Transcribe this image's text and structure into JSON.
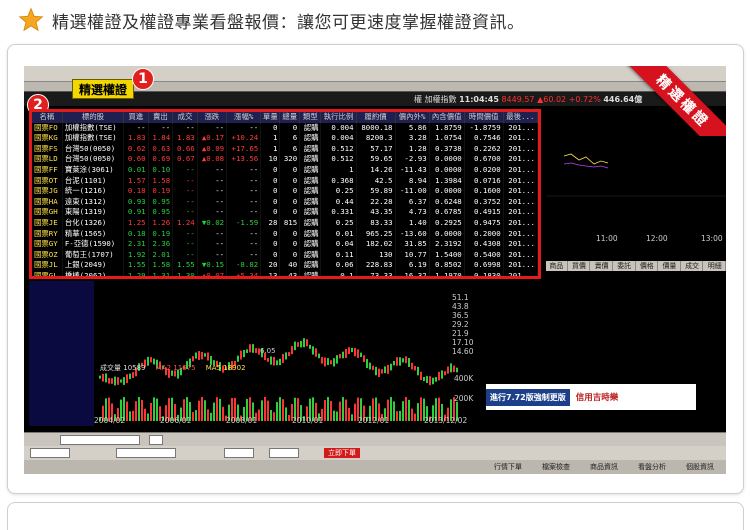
{
  "header": {
    "title": "精選權證及權證專業看盤報價：讓您可更速度掌握權證資訊。"
  },
  "screenshot": {
    "selected_tab": "精選權證",
    "badges": [
      "1",
      "2"
    ],
    "ribbon": "精選權證",
    "quote_prefix": "權",
    "quote_label": "加權指數",
    "quote_time": "11:04:45",
    "quote_index": "8449.57",
    "quote_change": "▲60.02",
    "quote_pct": "+0.72%",
    "quote_volume": "446.64億",
    "columns": [
      "名稱",
      "標的股",
      "買進",
      "賣出",
      "成交",
      "漲跌",
      "漲幅%",
      "單量",
      "總量",
      "類型",
      "執行比例",
      "履約價",
      "價內外%",
      "內含價值",
      "時間價值",
      "最後..."
    ],
    "rows": [
      [
        "國票FO",
        "加權指數(TSE)",
        "--",
        "--",
        "--",
        "--",
        "--",
        "0",
        "0",
        "認購",
        "0.004",
        "8000.18",
        "5.86",
        "1.8759",
        "-1.8759",
        "201..."
      ],
      [
        "國票KG",
        "加權指數(TSE)",
        "1.83",
        "1.84",
        "1.83",
        "▲0.17",
        "+10.24",
        "1",
        "6",
        "認購",
        "0.004",
        "8200.3",
        "3.28",
        "1.0754",
        "0.7546",
        "201..."
      ],
      [
        "國票FS",
        "台灣50(0050)",
        "0.62",
        "0.63",
        "0.66",
        "▲0.09",
        "+17.65",
        "1",
        "6",
        "認購",
        "0.512",
        "57.17",
        "1.28",
        "0.3738",
        "0.2262",
        "201..."
      ],
      [
        "國票LD",
        "台灣50(0050)",
        "0.60",
        "0.69",
        "0.67",
        "▲0.08",
        "+13.56",
        "10",
        "320",
        "認購",
        "0.512",
        "59.65",
        "-2.93",
        "0.0000",
        "0.6700",
        "201..."
      ],
      [
        "國票FF",
        "寶萊涂(3061)",
        "0.01",
        "0.10",
        "--",
        "--",
        "--",
        "0",
        "0",
        "認購",
        "1",
        "14.26",
        "-11.43",
        "0.0000",
        "0.0200",
        "201..."
      ],
      [
        "國票OT",
        "台泥(1101)",
        "1.57",
        "1.58",
        "--",
        "--",
        "--",
        "0",
        "0",
        "認購",
        "0.368",
        "42.5",
        "8.94",
        "1.3984",
        "0.0716",
        "201..."
      ],
      [
        "國票JG",
        "統一(1216)",
        "0.18",
        "0.19",
        "--",
        "--",
        "--",
        "0",
        "0",
        "認購",
        "0.25",
        "59.89",
        "-11.00",
        "0.0000",
        "0.1600",
        "201..."
      ],
      [
        "國票HA",
        "遠東(1312)",
        "0.93",
        "0.95",
        "--",
        "--",
        "--",
        "0",
        "0",
        "認購",
        "0.44",
        "22.28",
        "6.37",
        "0.6248",
        "0.3752",
        "201..."
      ],
      [
        "國票GH",
        "東陽(1319)",
        "0.91",
        "0.95",
        "--",
        "--",
        "--",
        "0",
        "0",
        "認購",
        "0.331",
        "43.35",
        "4.73",
        "0.6785",
        "0.4915",
        "201..."
      ],
      [
        "國票JE",
        "台化(1326)",
        "1.25",
        "1.26",
        "1.24",
        "▼0.02",
        "-1.59",
        "28",
        "815",
        "認購",
        "0.25",
        "83.33",
        "1.40",
        "0.2925",
        "0.9475",
        "201..."
      ],
      [
        "國票RY",
        "精華(1565)",
        "0.18",
        "0.19",
        "--",
        "--",
        "--",
        "0",
        "0",
        "認購",
        "0.01",
        "965.25",
        "-13.60",
        "0.0000",
        "0.2000",
        "201..."
      ],
      [
        "國票GY",
        "F-亞德(1590)",
        "2.31",
        "2.36",
        "--",
        "--",
        "--",
        "0",
        "0",
        "認購",
        "0.04",
        "182.02",
        "31.85",
        "2.3192",
        "0.4308",
        "201..."
      ],
      [
        "國票OZ",
        "葡萄王(1707)",
        "1.92",
        "2.01",
        "--",
        "--",
        "--",
        "0",
        "0",
        "認購",
        "0.11",
        "130",
        "10.77",
        "1.5400",
        "0.5400",
        "201..."
      ],
      [
        "國票JL",
        "上銀(2049)",
        "1.55",
        "1.58",
        "1.55",
        "▼0.15",
        "-8.82",
        "20",
        "40",
        "認購",
        "0.06",
        "228.83",
        "6.19",
        "0.8502",
        "0.6998",
        "201..."
      ],
      [
        "國票GL",
        "橋椿(2062)",
        "1.29",
        "1.31",
        "1.30",
        "▲0.07",
        "+5.34",
        "13",
        "43",
        "認購",
        "0.1",
        "73.33",
        "16.32",
        "1.1970",
        "0.1830",
        "201..."
      ],
      [
        "國票KF",
        "正新(2105)",
        "0.22",
        "0.23",
        "0.18",
        "▼0.01",
        "-5.26",
        "1",
        "1",
        "認購",
        "0.2",
        "86.89",
        "-12.42",
        "0.0000",
        "0.1800",
        "201..."
      ],
      [
        "國票FF",
        "建大(2106)",
        "--",
        "--",
        "--",
        "--",
        "--",
        "0",
        "0",
        "認購",
        "0.161",
        "67.85",
        "-7.59",
        "0.0000",
        "0.0000",
        "201..."
      ]
    ],
    "row_colors": [
      "w",
      "r",
      "r",
      "r",
      "g",
      "r",
      "r",
      "g",
      "g",
      "r",
      "g",
      "g",
      "g",
      "g",
      "g",
      "r",
      "g"
    ],
    "change_colors": [
      "",
      "r",
      "r",
      "r",
      "",
      "",
      "",
      "",
      "",
      "g",
      "",
      "",
      "",
      "g",
      "r",
      "g",
      ""
    ],
    "time_axis": [
      "11:00",
      "12:00",
      "13:00"
    ],
    "right_tabs": [
      "商品",
      "買價",
      "賣價",
      "委託",
      "價格",
      "價量",
      "成交",
      "明細"
    ],
    "y_axis": [
      "51.1",
      "43.8",
      "36.5",
      "29.2",
      "21.9",
      "17.10",
      "14.60"
    ],
    "vol_axis": [
      "400K",
      "200K"
    ],
    "volume_legend": {
      "label": "成交量",
      "value": "10589",
      "ma2": "MA2 11675",
      "ma5": "MA5 18902"
    },
    "date_axis": [
      "2004/02",
      "2006/01",
      "2008/01",
      "2010/01",
      "2012/01",
      "2013/12/02"
    ],
    "chart_low": "6.05",
    "ad_left": "進行7.72版強制更版",
    "ad_right": "信用吉時樂",
    "bottom_btn": "立即下單",
    "status_items": [
      "行情下單",
      "檔案檢查",
      "商品資訊",
      "看盤分析",
      "個股資訊"
    ]
  }
}
